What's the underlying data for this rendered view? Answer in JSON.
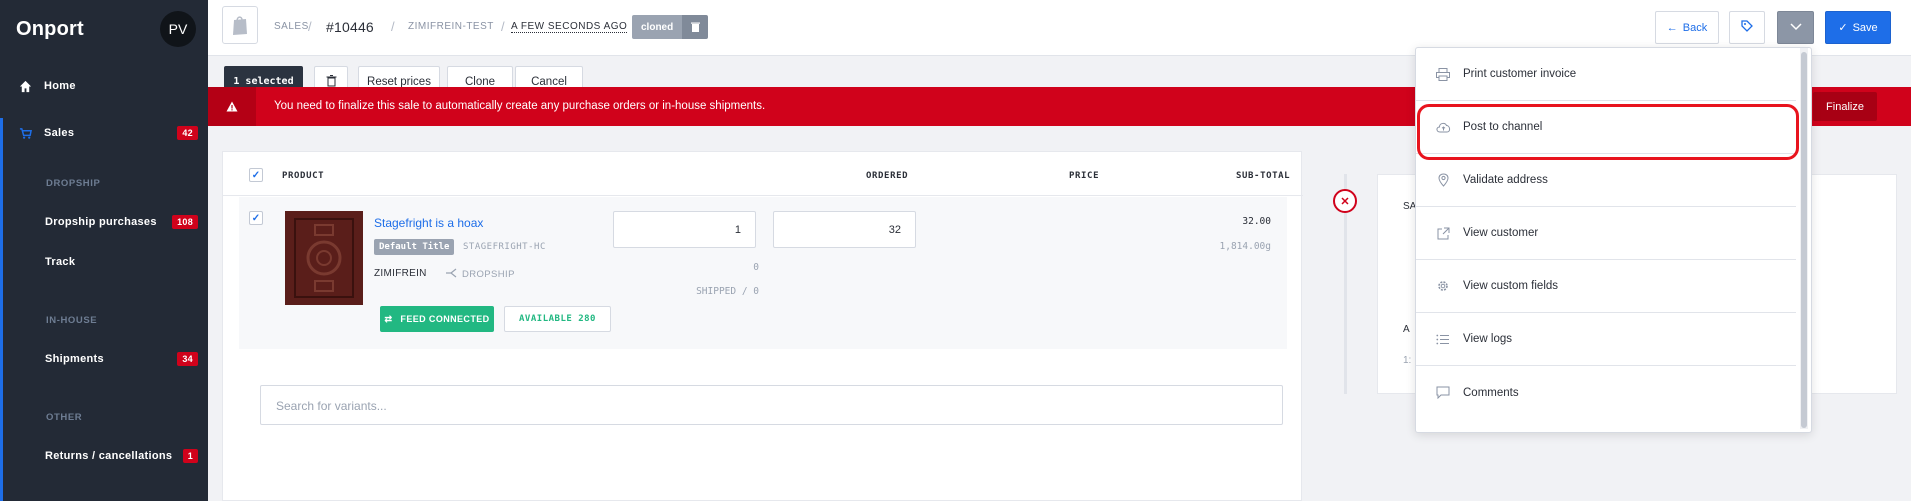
{
  "sidebar": {
    "brand": "Onport",
    "avatar": "PV",
    "items": [
      {
        "label": "Home"
      },
      {
        "label": "Sales",
        "badge": "42"
      },
      {
        "label": "Dropship purchases",
        "badge": "108"
      },
      {
        "label": "Track"
      },
      {
        "label": "Shipments",
        "badge": "34"
      },
      {
        "label": "Returns / cancellations",
        "badge": "1"
      }
    ],
    "sections": [
      "DROPSHIP",
      "IN-HOUSE",
      "OTHER"
    ]
  },
  "header": {
    "breadcrumb_sales": "SALES",
    "order_number": "#10446",
    "store": "ZIMIFREIN-TEST",
    "time": "A FEW SECONDS AGO",
    "status_pill": "cloned",
    "back_label": "Back",
    "save_label": "Save"
  },
  "actions": {
    "selected": "1 selected",
    "reset_prices": "Reset prices",
    "clone": "Clone",
    "cancel": "Cancel"
  },
  "alert": {
    "text": "You need to finalize this sale to automatically create any purchase orders or in-house shipments.",
    "finalize": "Finalize"
  },
  "table": {
    "headers": {
      "product": "PRODUCT",
      "ordered": "ORDERED",
      "price": "PRICE",
      "subtotal": "SUB-TOTAL"
    },
    "row": {
      "title": "Stagefright is a hoax",
      "variant": "Default Title",
      "sku": "STAGEFRIGHT-HC",
      "vendor": "ZIMIFREIN",
      "fulfillment": "DROPSHIP",
      "ordered_value": "1",
      "price_value": "32",
      "subtotal": "32.00",
      "weight": "1,814.00g",
      "zero": "0",
      "shipped_label": "SHIPPED / 0",
      "feed": "FEED CONNECTED",
      "available": "AVAILABLE 280"
    },
    "search_placeholder": "Search for variants..."
  },
  "side_card": {
    "t1": "SA",
    "t2": "A",
    "t3": "1:"
  },
  "menu": {
    "items": [
      {
        "label": "Print customer invoice",
        "icon": "printer-icon"
      },
      {
        "label": "Post to channel",
        "icon": "cloud-upload-icon"
      },
      {
        "label": "Validate address",
        "icon": "map-pin-icon"
      },
      {
        "label": "View customer",
        "icon": "external-link-icon"
      },
      {
        "label": "View custom fields",
        "icon": "gear-icon"
      },
      {
        "label": "View logs",
        "icon": "list-icon"
      },
      {
        "label": "Comments",
        "icon": "comment-icon"
      }
    ]
  },
  "colors": {
    "accent": "#1e6ee8",
    "danger": "#d0021b",
    "success": "#22b882",
    "sidebar": "#232a36"
  }
}
